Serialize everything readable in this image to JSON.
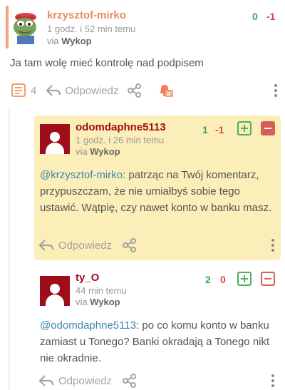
{
  "colors": {
    "accent_orange": "#e88a5e",
    "author_red": "#a00d1a",
    "plus_green": "#3aa556",
    "minus_red": "#d8433e",
    "highlight_bg": "#fbeeb8",
    "mention_blue": "#3d86b0"
  },
  "main_comment": {
    "author": "krzysztof-mirko",
    "time": "1 godz. i 52 min temu",
    "via_prefix": "via",
    "via_app": "Wykop",
    "score_plus": "0",
    "score_minus": "-1",
    "text": "Ja tam wolę mieć kontrolę nad podpisem",
    "comments_count": "4",
    "reply_label": "Odpowiedz",
    "icons": [
      "comments-icon",
      "reply-arrow-icon",
      "share-icon",
      "notification-bell-icon",
      "more-dots-icon"
    ]
  },
  "replies": [
    {
      "author": "odomdaphne5113",
      "time": "1 godz. i 26 min temu",
      "via_prefix": "via",
      "via_app": "Wykop",
      "score_plus": "1",
      "score_minus": "-1",
      "mention": "@krzysztof-mirko",
      "text": ": patrząc na Twój komentarz, przypuszczam, że nie umiałbyś sobie tego ustawić. Wątpię, czy nawet konto w banku masz.",
      "reply_label": "Odpowiedz",
      "highlighted": true
    },
    {
      "author": "ty_O",
      "time": "44 min temu",
      "via_prefix": "via",
      "via_app": "Wykop",
      "score_plus": "2",
      "score_minus": "0",
      "mention": "@odomdaphne5113",
      "text": ": po co komu konto w banku zamiast u Tonego? Banki okradają a Tonego nikt nie okradnie.",
      "reply_label": "Odpowiedz",
      "highlighted": false
    }
  ]
}
